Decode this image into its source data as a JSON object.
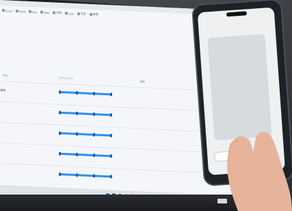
{
  "bookmarks": [
    {
      "icon": "doc-icon",
      "label": "Excel"
    },
    {
      "icon": "doc-icon",
      "label": "Word"
    },
    {
      "icon": "folder-icon",
      "label": "Box"
    },
    {
      "icon": "globe-icon",
      "label": "Web"
    },
    {
      "icon": "star-icon",
      "label": "共有"
    },
    {
      "icon": "link-icon",
      "label": "Link"
    },
    {
      "icon": "calendar-icon",
      "label": "予定"
    },
    {
      "icon": "person-icon",
      "label": "管理"
    }
  ],
  "header": {
    "left_title": "",
    "cells": [
      "",
      "",
      "",
      "",
      ""
    ]
  },
  "columns": {
    "name": "氏名",
    "timeline": "スケジュール",
    "notes": "備考"
  },
  "rows": [
    {
      "label": "業務",
      "date": "",
      "ticks": 4,
      "notes": [
        "",
        "",
        ""
      ]
    },
    {
      "label": "",
      "date": "",
      "ticks": 4,
      "notes": [
        "",
        "",
        ""
      ]
    },
    {
      "label": "",
      "date": "",
      "ticks": 4,
      "notes": [
        "",
        "",
        ""
      ]
    },
    {
      "label": "",
      "date": "",
      "ticks": 4,
      "notes": [
        "",
        "",
        ""
      ]
    },
    {
      "label": "",
      "date": "",
      "ticks": 4,
      "notes": [
        "",
        "",
        ""
      ]
    }
  ],
  "phone": {
    "title": "",
    "chat_lines": [
      "",
      "",
      "",
      "",
      "",
      "",
      "",
      "",
      "",
      "",
      "",
      "",
      "",
      "",
      "",
      "",
      "",
      "",
      ""
    ],
    "buttons": [
      "",
      ""
    ]
  },
  "colors": {
    "timeline_blue": "#2f8fe8",
    "tick_blue": "#1a5fc0",
    "screen_bg": "#f4f6f9",
    "phone_body": "#1e2228",
    "skin": "#e6b49a"
  }
}
